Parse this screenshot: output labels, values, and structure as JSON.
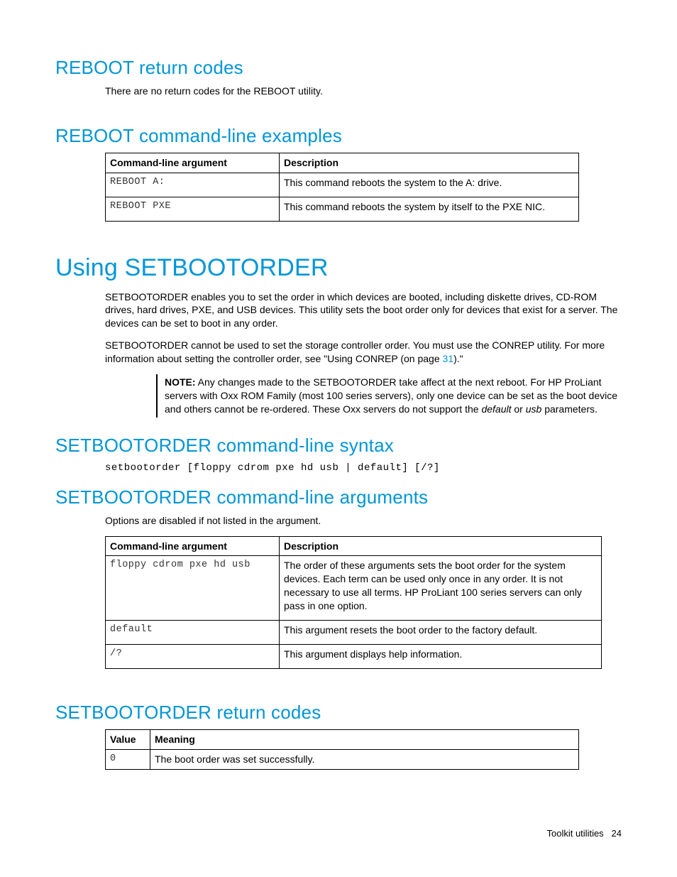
{
  "sections": {
    "reboot_codes": {
      "heading": "REBOOT return codes",
      "body": "There are no return codes for the REBOOT utility."
    },
    "reboot_examples": {
      "heading": "REBOOT command-line examples",
      "th_arg": "Command-line argument",
      "th_desc": "Description",
      "rows": [
        {
          "arg": "REBOOT A:",
          "desc": "This command reboots the system to the A: drive."
        },
        {
          "arg": "REBOOT PXE",
          "desc": "This command reboots the system by itself to the PXE NIC."
        }
      ]
    },
    "using_setbootorder": {
      "heading": "Using SETBOOTORDER",
      "p1": "SETBOOTORDER enables you to set the order in which devices are booted, including diskette drives, CD-ROM drives, hard drives, PXE, and USB devices. This utility sets the boot order only for devices that exist for a server. The devices can be set to boot in any order.",
      "p2_a": "SETBOOTORDER cannot be used to set the storage controller order. You must use the CONREP utility. For more information about setting the controller order, see \"Using CONREP (on page ",
      "p2_link": "31",
      "p2_b": ").\"",
      "note_label": "NOTE:",
      "note_a": "  Any changes made to the SETBOOTORDER take affect at the next reboot. For HP ProLiant servers with Oxx ROM Family (most 100 series servers), only one device can be set as the boot device and others cannot be re-ordered. These Oxx servers do not support the ",
      "note_i1": "default",
      "note_mid": " or ",
      "note_i2": "usb",
      "note_end": " parameters."
    },
    "sbo_syntax": {
      "heading": "SETBOOTORDER command-line syntax",
      "code": "setbootorder [floppy cdrom pxe hd usb | default] [/?]"
    },
    "sbo_args": {
      "heading": "SETBOOTORDER command-line arguments",
      "intro": "Options are disabled if not listed in the argument.",
      "th_arg": "Command-line argument",
      "th_desc": "Description",
      "rows": [
        {
          "arg": "floppy cdrom pxe hd usb",
          "desc": "The order of these arguments sets the boot order for the system devices. Each term can be used only once in any order. It is not necessary to use all terms. HP ProLiant 100 series servers can only pass in one option."
        },
        {
          "arg": "default",
          "desc": "This argument resets the boot order to the factory default."
        },
        {
          "arg": "/?",
          "desc": "This argument displays help information."
        }
      ]
    },
    "sbo_return": {
      "heading": "SETBOOTORDER return codes",
      "th_val": "Value",
      "th_mean": "Meaning",
      "rows": [
        {
          "val": "0",
          "mean": "The boot order was set successfully."
        }
      ]
    }
  },
  "footer": {
    "section": "Toolkit utilities",
    "page": "24"
  }
}
